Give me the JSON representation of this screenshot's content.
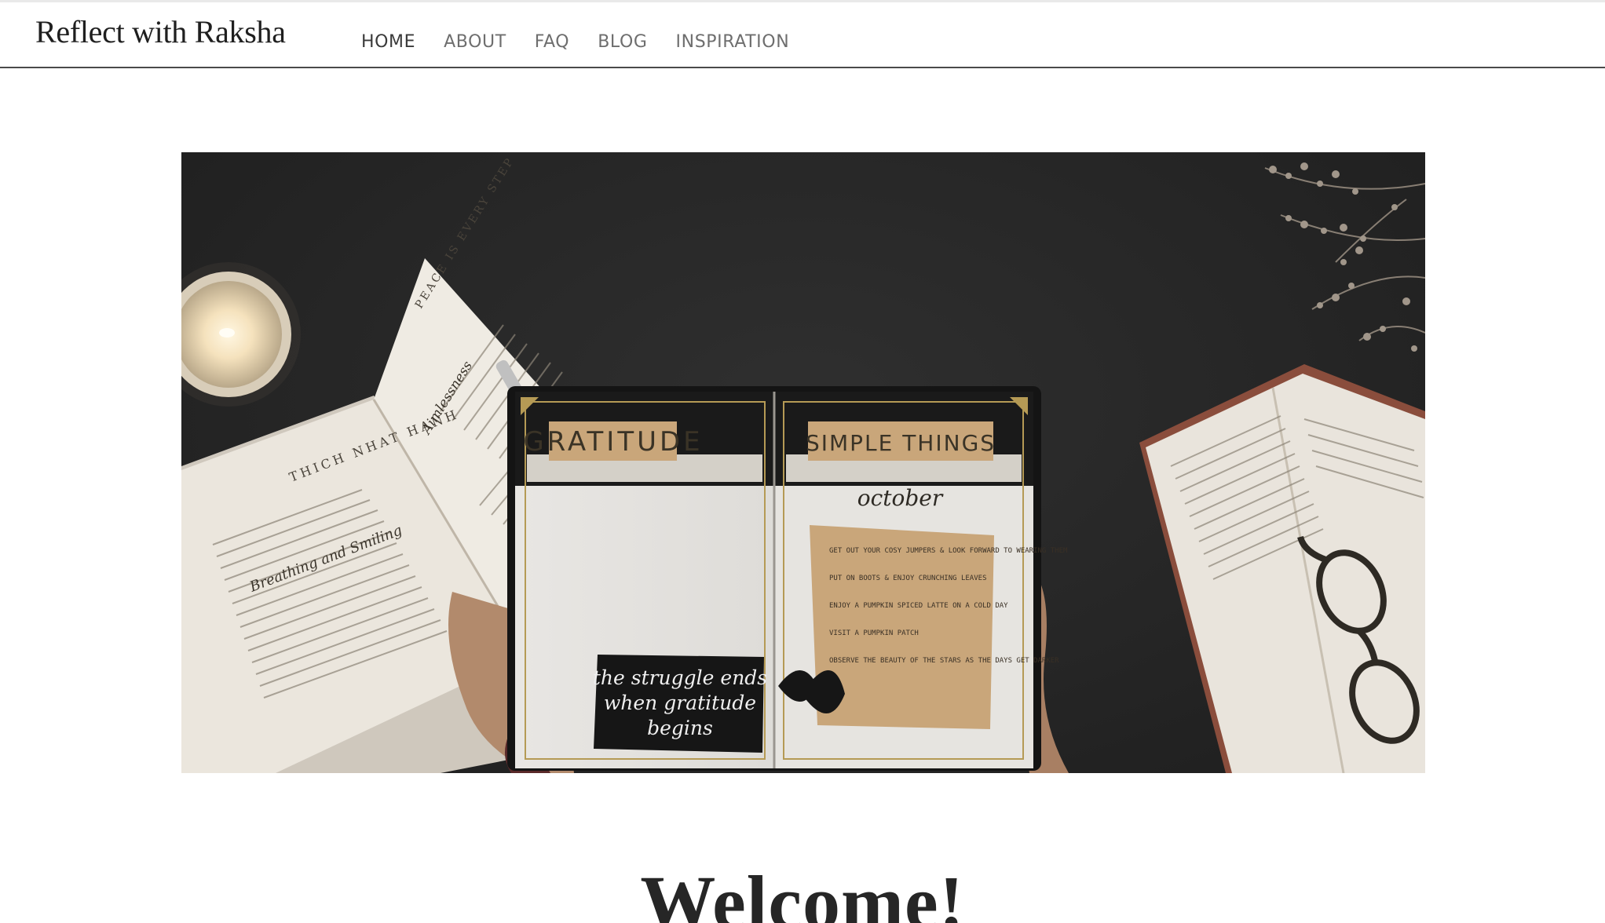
{
  "site": {
    "title": "Reflect with Raksha"
  },
  "nav": [
    {
      "label": "HOME",
      "active": true
    },
    {
      "label": "ABOUT",
      "active": false
    },
    {
      "label": "FAQ",
      "active": false
    },
    {
      "label": "BLOG",
      "active": false
    },
    {
      "label": "INSPIRATION",
      "active": false
    }
  ],
  "hero": {
    "journal": {
      "left_heading": "GRATITUDE",
      "right_heading": "SIMPLE THINGS",
      "month": "october",
      "quote_lines": [
        "the struggle ends",
        "when gratitude",
        "begins"
      ],
      "list_items": [
        "GET OUT YOUR COSY JUMPERS & LOOK FORWARD TO WEARING THEM",
        "PUT ON BOOTS & ENJOY CRUNCHING LEAVES",
        "ENJOY A PUMPKIN SPICED LATTE ON A COLD DAY",
        "VISIT A PUMPKIN PATCH",
        "OBSERVE THE BEAUTY OF THE STARS AS THE DAYS GET DARKER"
      ]
    },
    "book": {
      "running_head": "PEACE IS EVERY STEP",
      "chapter": "Aimlessness",
      "left_head": "THICH NHAT HANH",
      "left_chapter": "Breathing and Smiling"
    }
  },
  "main": {
    "heading": "Welcome!"
  },
  "colors": {
    "nav_active": "#3a3a3a",
    "nav_inactive": "#6e6e6e",
    "rule": "#4a4a4a",
    "kraft": "#c9a67a"
  }
}
